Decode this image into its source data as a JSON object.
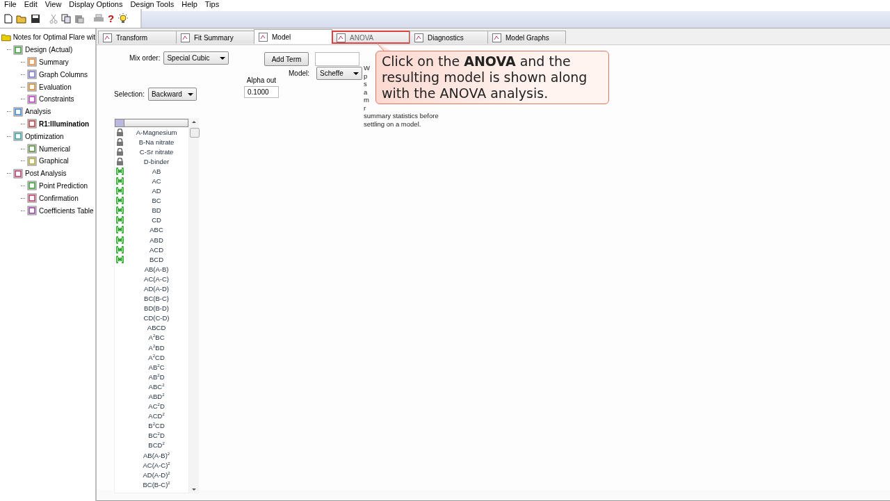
{
  "menu": [
    "File",
    "Edit",
    "View",
    "Display Options",
    "Design Tools",
    "Help",
    "Tips"
  ],
  "toolbar": {
    "help_glyph": "?"
  },
  "tree": {
    "label": "Notes for Optimal Flare wit",
    "selected": false,
    "children": [
      {
        "label": "Design (Actual)",
        "selected": false,
        "children": [
          {
            "label": "Summary",
            "selected": false
          },
          {
            "label": "Graph Columns",
            "selected": false
          },
          {
            "label": "Evaluation",
            "selected": false
          },
          {
            "label": "Constraints",
            "selected": false
          }
        ]
      },
      {
        "label": "Analysis",
        "selected": false,
        "children": [
          {
            "label": "R1:Illumination",
            "selected": true
          }
        ]
      },
      {
        "label": "Optimization",
        "selected": false,
        "children": [
          {
            "label": "Numerical",
            "selected": false
          },
          {
            "label": "Graphical",
            "selected": false
          }
        ]
      },
      {
        "label": "Post Analysis",
        "selected": false,
        "children": [
          {
            "label": "Point Prediction",
            "selected": false
          },
          {
            "label": "Confirmation",
            "selected": false
          },
          {
            "label": "Coefficients Table",
            "selected": false
          }
        ]
      }
    ]
  },
  "tabs": [
    {
      "label": "Transform",
      "selected": false,
      "highlighted": false
    },
    {
      "label": "Fit Summary",
      "selected": false,
      "highlighted": false
    },
    {
      "label": "Model",
      "selected": true,
      "highlighted": false
    },
    {
      "label": "ANOVA",
      "selected": false,
      "highlighted": true
    },
    {
      "label": "Diagnostics",
      "selected": false,
      "highlighted": false
    },
    {
      "label": "Model Graphs",
      "selected": false,
      "highlighted": false
    }
  ],
  "mix_order": {
    "label": "Mix order:",
    "value": "Special Cubic"
  },
  "add_term": "Add Term",
  "selection": {
    "label": "Selection:",
    "value": "Backward"
  },
  "alpha_out": {
    "label": "Alpha out",
    "value": "0.1000"
  },
  "model": {
    "label": "Model:",
    "value": "Scheffe"
  },
  "help_text": [
    "W",
    "p",
    "s",
    "a",
    "m",
    "r",
    "summary statistics before",
    "settling on a model."
  ],
  "terms": [
    {
      "label": "A-Magnesium",
      "kind": "locked"
    },
    {
      "label": "B-Na nitrate",
      "kind": "locked"
    },
    {
      "label": "C-Sr nitrate",
      "kind": "locked"
    },
    {
      "label": "D-binder",
      "kind": "locked"
    },
    {
      "label": "AB",
      "kind": "model"
    },
    {
      "label": "AC",
      "kind": "model"
    },
    {
      "label": "AD",
      "kind": "model"
    },
    {
      "label": "BC",
      "kind": "model"
    },
    {
      "label": "BD",
      "kind": "model"
    },
    {
      "label": "CD",
      "kind": "model"
    },
    {
      "label": "ABC",
      "kind": "model"
    },
    {
      "label": "ABD",
      "kind": "model"
    },
    {
      "label": "ACD",
      "kind": "model"
    },
    {
      "label": "BCD",
      "kind": "model"
    },
    {
      "label": "AB(A-B)",
      "kind": "none"
    },
    {
      "label": "AC(A-C)",
      "kind": "none"
    },
    {
      "label": "AD(A-D)",
      "kind": "none"
    },
    {
      "label": "BC(B-C)",
      "kind": "none"
    },
    {
      "label": "BD(B-D)",
      "kind": "none"
    },
    {
      "label": "CD(C-D)",
      "kind": "none"
    },
    {
      "label": "ABCD",
      "kind": "none"
    },
    {
      "label": "A$^{2}$BC",
      "kind": "none"
    },
    {
      "label": "A$^{2}$BD",
      "kind": "none"
    },
    {
      "label": "A$^{2}$CD",
      "kind": "none"
    },
    {
      "label": "AB$^{2}$C",
      "kind": "none"
    },
    {
      "label": "AB$^{2}$D",
      "kind": "none"
    },
    {
      "label": "ABC$^{2}$",
      "kind": "none"
    },
    {
      "label": "ABD$^{2}$",
      "kind": "none"
    },
    {
      "label": "AC$^{2}$D",
      "kind": "none"
    },
    {
      "label": "ACD$^{2}$",
      "kind": "none"
    },
    {
      "label": "B$^{2}$CD",
      "kind": "none"
    },
    {
      "label": "BC$^{2}$D",
      "kind": "none"
    },
    {
      "label": "BCD$^{2}$",
      "kind": "none"
    },
    {
      "label": "AB(A-B)$^{2}$",
      "kind": "none"
    },
    {
      "label": "AC(A-C)$^{2}$",
      "kind": "none"
    },
    {
      "label": "AD(A-D)$^{2}$",
      "kind": "none"
    },
    {
      "label": "BC(B-C)$^{2}$",
      "kind": "none"
    }
  ],
  "callout": "Click on the **ANOVA** and the resulting model is shown along with the ANOVA analysis."
}
